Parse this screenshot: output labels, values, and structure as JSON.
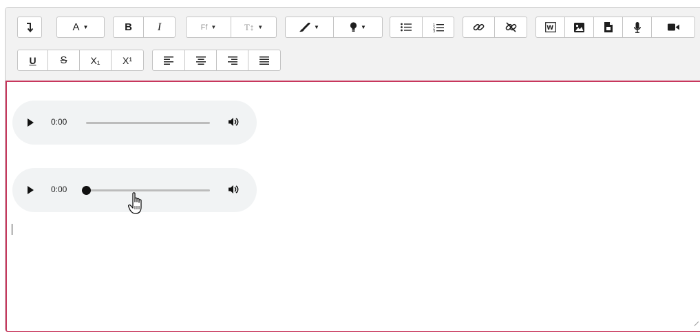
{
  "toolbar": {
    "row1": [
      {
        "name": "collapse-toggle-button",
        "icon": "arrow-turn-down-icon"
      },
      {
        "name": "heading-menu-button",
        "label": "A",
        "icon": "caret-down-icon"
      },
      {
        "name": "bold-button",
        "label": "B"
      },
      {
        "name": "italic-button",
        "label": "I"
      },
      {
        "name": "font-family-button",
        "label": "Ff",
        "icon": "caret-down-icon"
      },
      {
        "name": "font-size-button",
        "label": "T↕",
        "icon": "caret-down-icon"
      },
      {
        "name": "font-color-button",
        "icon": "brush-icon"
      },
      {
        "name": "background-color-button",
        "icon": "lightbulb-icon"
      },
      {
        "name": "unordered-list-button",
        "icon": "list-ul-icon"
      },
      {
        "name": "ordered-list-button",
        "icon": "list-ol-icon"
      },
      {
        "name": "link-button",
        "icon": "link-icon"
      },
      {
        "name": "unlink-button",
        "icon": "unlink-icon"
      },
      {
        "name": "word-paste-button",
        "icon": "word-icon"
      },
      {
        "name": "image-button",
        "icon": "image-icon"
      },
      {
        "name": "media-button",
        "icon": "file-icon"
      },
      {
        "name": "record-audio-button",
        "icon": "microphone-icon"
      },
      {
        "name": "record-video-button",
        "icon": "video-camera-icon"
      }
    ],
    "row2": [
      {
        "name": "underline-button",
        "label": "U"
      },
      {
        "name": "strikethrough-button",
        "label": "S"
      },
      {
        "name": "subscript-button",
        "label": "X₁"
      },
      {
        "name": "superscript-button",
        "label": "X¹"
      },
      {
        "name": "align-left-button",
        "icon": "align-left-icon"
      },
      {
        "name": "align-center-button",
        "icon": "align-center-icon"
      },
      {
        "name": "align-right-button",
        "icon": "align-right-icon"
      },
      {
        "name": "align-justify-button",
        "icon": "align-justify-icon"
      }
    ]
  },
  "content": {
    "players": [
      {
        "time": "0:00",
        "progress": 0
      },
      {
        "time": "0:00",
        "progress": 0
      }
    ]
  },
  "colors": {
    "focus_border": "#c8375d",
    "toolbar_bg": "#f2f2f2",
    "player_bg": "#f1f3f4"
  },
  "cursor": {
    "icon": "hand-pointer-icon"
  }
}
